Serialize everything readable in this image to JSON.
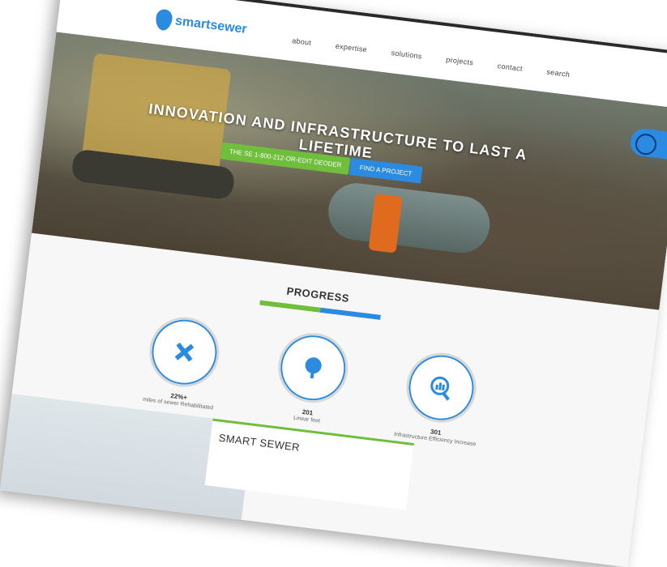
{
  "brand": {
    "logo_text": "smartsewer"
  },
  "nav": {
    "items": [
      "about",
      "expertise",
      "solutions",
      "projects",
      "contact",
      "search"
    ]
  },
  "hero": {
    "headline": "INNOVATION AND INFRASTRUCTURE TO LAST A LIFETIME",
    "primary_cta": "THE SE 1-800-212-OR-EDIT DEODER",
    "secondary_cta": "FIND A PROJECT"
  },
  "progress": {
    "title": "PROGRESS",
    "stats": [
      {
        "icon": "wrench-cross-icon",
        "value": "22%+",
        "label": "miles of sewer Rehabilitated"
      },
      {
        "icon": "tree-icon",
        "value": "201",
        "label": "Linear feet"
      },
      {
        "icon": "chart-magnifier-icon",
        "value": "301",
        "label": "Infrastructure Efficiency Increase"
      }
    ]
  },
  "footer": {
    "card_title": "SMART SEWER"
  },
  "colors": {
    "brand_blue": "#2a8be0",
    "brand_green": "#6fbe3c"
  }
}
